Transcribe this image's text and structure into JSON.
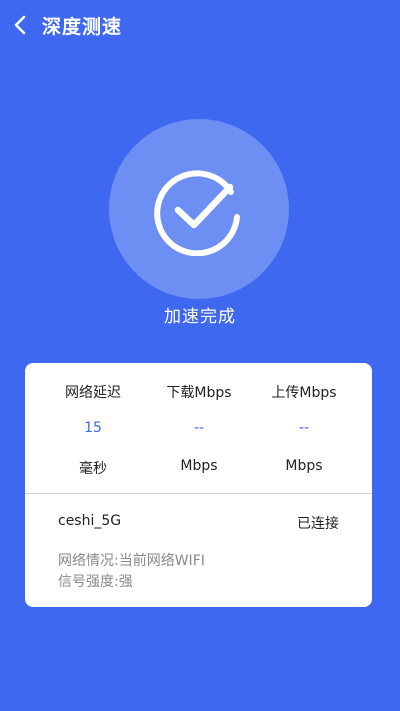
{
  "header": {
    "title": "深度测速",
    "back_icon": "chevron-left-icon"
  },
  "result": {
    "icon": "check-circle-icon",
    "status_text": "加速完成"
  },
  "metrics": [
    {
      "label": "网络延迟",
      "value": "15",
      "unit": "毫秒"
    },
    {
      "label": "下载Mbps",
      "value": "--",
      "unit": "Mbps"
    },
    {
      "label": "上传Mbps",
      "value": "--",
      "unit": "Mbps"
    }
  ],
  "network": {
    "name": "ceshi_5G",
    "status": "已连接",
    "situation": "网络情况:当前网络WIFI",
    "signal": "信号强度:强"
  },
  "colors": {
    "background": "#3d68ef",
    "circle": "#6d8ff4",
    "accent": "#3d68ef",
    "card": "#ffffff"
  }
}
